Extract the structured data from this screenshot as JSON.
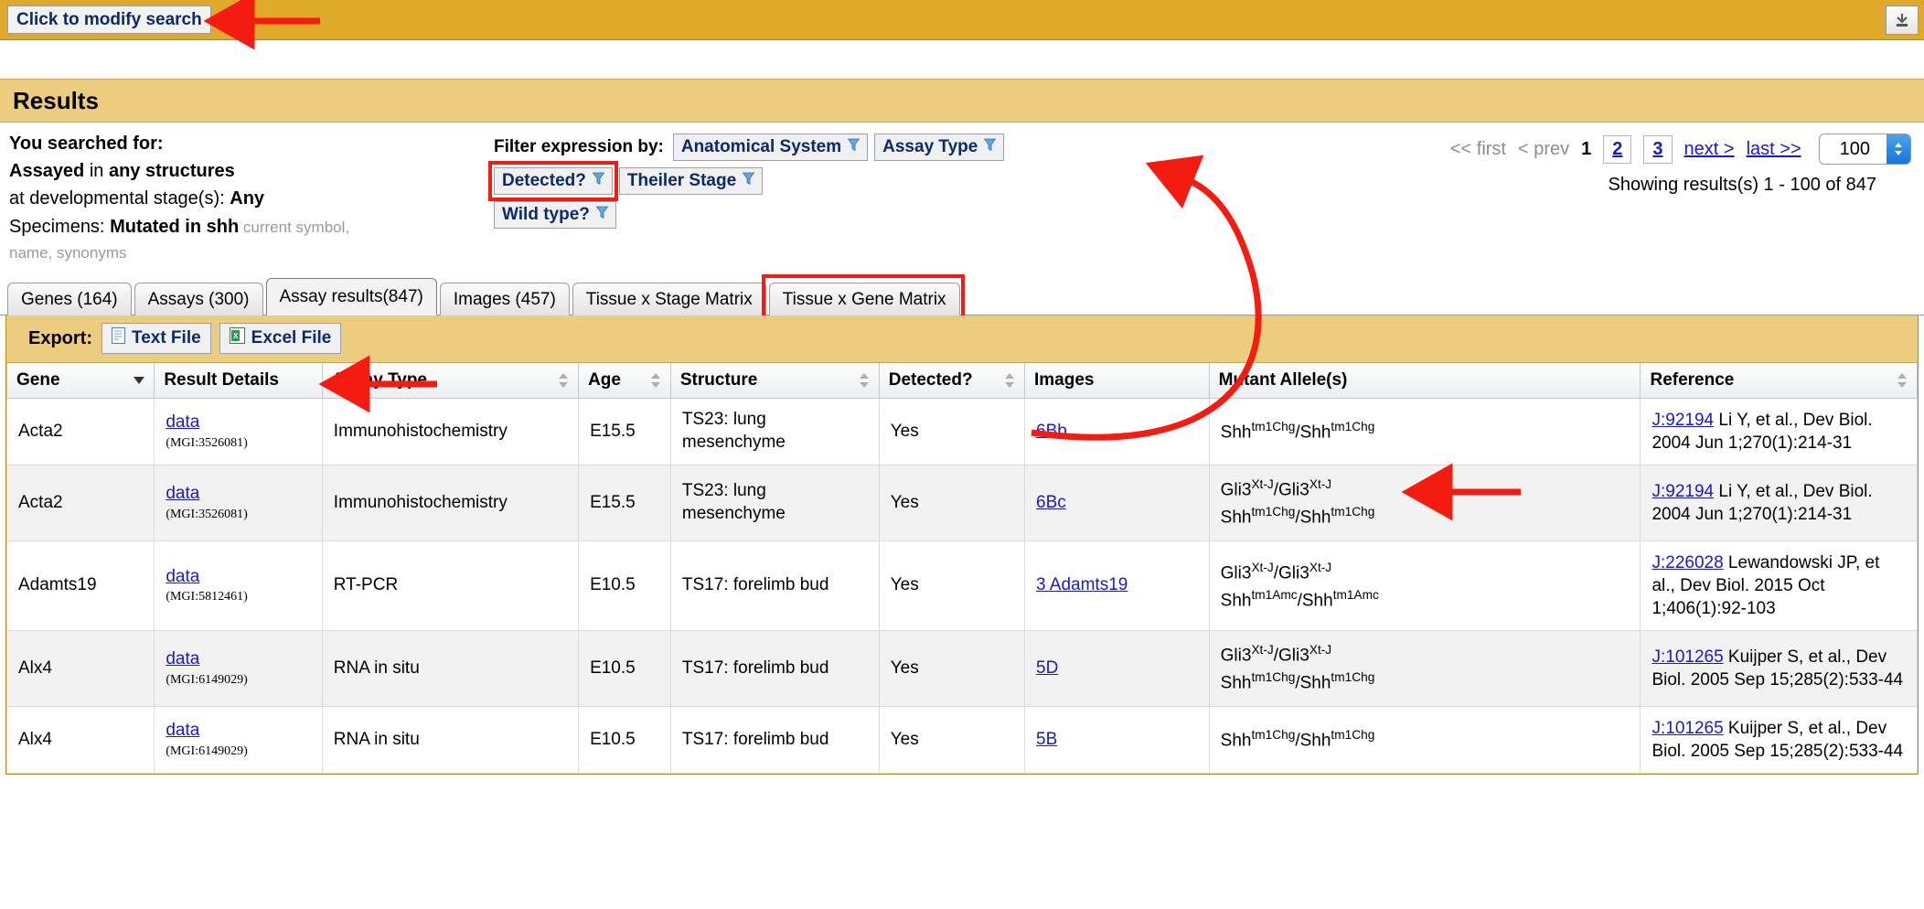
{
  "topbar": {
    "modify_search_label": "Click to modify search",
    "collapse_icon": "collapse-down-icon",
    "bar_color": "#e0a92a"
  },
  "results_header": {
    "title": "Results"
  },
  "search_summary": {
    "heading": "You searched for:",
    "line_assayed_bold": "Assayed",
    "line_assayed_mid": " in ",
    "line_assayed_bold2": "any structures",
    "line_stage_label": "at developmental stage(s): ",
    "line_stage_value": "Any",
    "line_specimens_label": "Specimens: ",
    "line_specimens_value": "Mutated in shh",
    "line_specimens_note": " current symbol,",
    "line_specimens_note2": "name, synonyms"
  },
  "filters": {
    "label": "Filter expression by:",
    "funnel_icon": "funnel-icon",
    "buttons": [
      {
        "label": "Anatomical System",
        "highlighted": false
      },
      {
        "label": "Assay Type",
        "highlighted": false
      },
      {
        "label": "Detected?",
        "highlighted": true
      },
      {
        "label": "Theiler Stage",
        "highlighted": false
      },
      {
        "label": "Wild type?",
        "highlighted": false
      }
    ],
    "highlight_color": "#f41b10"
  },
  "pagination": {
    "first": "<< first",
    "prev": "< prev",
    "current_page": "1",
    "pages": [
      "2",
      "3"
    ],
    "next": "next >",
    "last": "last >>",
    "page_size": "100",
    "showing": "Showing results(s) 1 - 100 of 847"
  },
  "tabs": [
    {
      "label": "Genes (164)",
      "active": false,
      "highlighted": false
    },
    {
      "label": "Assays (300)",
      "active": false,
      "highlighted": false
    },
    {
      "label": "Assay results(847)",
      "active": true,
      "highlighted": false
    },
    {
      "label": "Images (457)",
      "active": false,
      "highlighted": false
    },
    {
      "label": "Tissue x Stage Matrix",
      "active": false,
      "highlighted": false
    },
    {
      "label": "Tissue x Gene Matrix",
      "active": false,
      "highlighted": true
    }
  ],
  "export": {
    "label": "Export:",
    "text_file_label": "Text File",
    "text_file_icon": "text-file-icon",
    "excel_file_label": "Excel File",
    "excel_file_icon": "excel-file-icon"
  },
  "table": {
    "columns": [
      {
        "label": "Gene",
        "sort": "desc"
      },
      {
        "label": "Result Details",
        "sort": "none"
      },
      {
        "label": "Assay Type",
        "sort": "updown"
      },
      {
        "label": "Age",
        "sort": "updown"
      },
      {
        "label": "Structure",
        "sort": "updown"
      },
      {
        "label": "Detected?",
        "sort": "updown"
      },
      {
        "label": "Images",
        "sort": "none"
      },
      {
        "label": "Mutant Allele(s)",
        "sort": "none"
      },
      {
        "label": "Reference",
        "sort": "updown"
      }
    ],
    "rows": [
      {
        "gene": "Acta2",
        "result_details_link": "data",
        "result_details_id": "(MGI:3526081)",
        "assay_type": "Immunohistochemistry",
        "age": "E15.5",
        "structure": "TS23: lung mesenchyme",
        "detected": "Yes",
        "images_link": "6Bb",
        "alleles": [
          {
            "gene": "Shh",
            "sup": "tm1Chg",
            "gene2": "Shh",
            "sup2": "tm1Chg"
          }
        ],
        "reference_link": "J:92194",
        "reference_text": " Li Y, et al., Dev Biol. 2004 Jun 1;270(1):214-31"
      },
      {
        "gene": "Acta2",
        "result_details_link": "data",
        "result_details_id": "(MGI:3526081)",
        "assay_type": "Immunohistochemistry",
        "age": "E15.5",
        "structure": "TS23: lung mesenchyme",
        "detected": "Yes",
        "images_link": "6Bc",
        "alleles": [
          {
            "gene": "Gli3",
            "sup": "Xt-J",
            "gene2": "Gli3",
            "sup2": "Xt-J"
          },
          {
            "gene": "Shh",
            "sup": "tm1Chg",
            "gene2": "Shh",
            "sup2": "tm1Chg"
          }
        ],
        "reference_link": "J:92194",
        "reference_text": " Li Y, et al., Dev Biol. 2004 Jun 1;270(1):214-31"
      },
      {
        "gene": "Adamts19",
        "result_details_link": "data",
        "result_details_id": "(MGI:5812461)",
        "assay_type": "RT-PCR",
        "age": "E10.5",
        "structure": "TS17: forelimb bud",
        "detected": "Yes",
        "images_link": "3 Adamts19",
        "alleles": [
          {
            "gene": "Gli3",
            "sup": "Xt-J",
            "gene2": "Gli3",
            "sup2": "Xt-J"
          },
          {
            "gene": "Shh",
            "sup": "tm1Amc",
            "gene2": "Shh",
            "sup2": "tm1Amc"
          }
        ],
        "reference_link": "J:226028",
        "reference_text": " Lewandowski JP, et al., Dev Biol. 2015 Oct 1;406(1):92-103"
      },
      {
        "gene": "Alx4",
        "result_details_link": "data",
        "result_details_id": "(MGI:6149029)",
        "assay_type": "RNA in situ",
        "age": "E10.5",
        "structure": "TS17: forelimb bud",
        "detected": "Yes",
        "images_link": "5D",
        "alleles": [
          {
            "gene": "Gli3",
            "sup": "Xt-J",
            "gene2": "Gli3",
            "sup2": "Xt-J"
          },
          {
            "gene": "Shh",
            "sup": "tm1Chg",
            "gene2": "Shh",
            "sup2": "tm1Chg"
          }
        ],
        "reference_link": "J:101265",
        "reference_text": " Kuijper S, et al., Dev Biol. 2005 Sep 15;285(2):533-44"
      },
      {
        "gene": "Alx4",
        "result_details_link": "data",
        "result_details_id": "(MGI:6149029)",
        "assay_type": "RNA in situ",
        "age": "E10.5",
        "structure": "TS17: forelimb bud",
        "detected": "Yes",
        "images_link": "5B",
        "alleles": [
          {
            "gene": "Shh",
            "sup": "tm1Chg",
            "gene2": "Shh",
            "sup2": "tm1Chg"
          }
        ],
        "reference_link": "J:101265",
        "reference_text": " Kuijper S, et al., Dev Biol. 2005 Sep 15;285(2):533-44"
      }
    ]
  },
  "annotations": {
    "arrow_color": "#f41b10",
    "count": 4
  }
}
